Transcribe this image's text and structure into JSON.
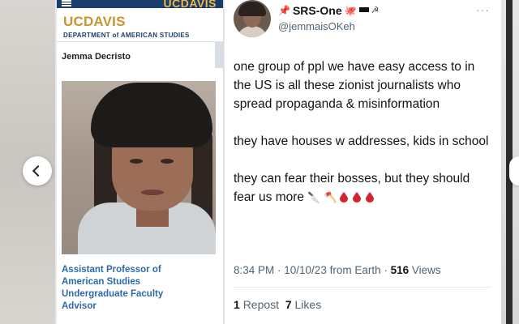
{
  "ucdavis": {
    "topbar_logo": "UCDAVIS",
    "logo": "UCDAVIS",
    "department": "DEPARTMENT of AMERICAN STUDIES",
    "person_name": "Jemma Decristo",
    "role_lines": [
      "Assistant Professor of",
      "American Studies",
      "Undergraduate Faculty",
      "Advisor"
    ]
  },
  "tweet": {
    "display_name": "SRS-One",
    "name_emojis": [
      "pushpin-icon",
      "octopus-icon",
      "flag-icon",
      "hammer-sickle-icon"
    ],
    "handle": "@jemmaisOKeh",
    "more": "···",
    "paragraphs": [
      "one group of ppl we have easy access to in the US is all these zionist journalists who spread propaganda & misinformation",
      "they have houses w addresses, kids in school",
      "they can fear their bosses, but they should fear us more"
    ],
    "trailing_emojis": [
      "knife-icon",
      "axe-icon",
      "blood-drop-icon",
      "blood-drop-icon",
      "blood-drop-icon"
    ],
    "time": "8:34 PM · 10/10/23 from Earth · ",
    "views_count": "516",
    "views_label": " Views",
    "repost_count": "1",
    "repost_label": "Repost",
    "likes_count": "7",
    "likes_label": "Likes"
  },
  "colors": {
    "ucd_navy": "#1b3d6d",
    "ucd_gold": "#c9952a",
    "ucd_link": "#2e6aa9",
    "blood": "#d1242f"
  }
}
